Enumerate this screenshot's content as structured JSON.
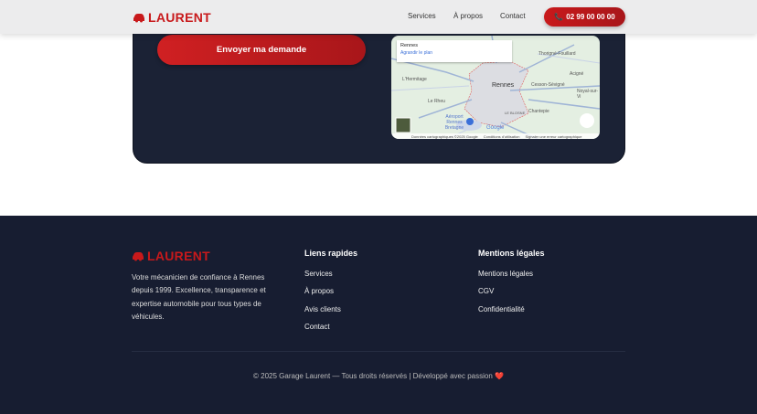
{
  "header": {
    "logo": "LAURENT",
    "nav": [
      "Services",
      "À propos",
      "Contact"
    ],
    "phone": "02 99 00 00 00"
  },
  "form": {
    "submit_label": "Envoyer ma demande"
  },
  "map": {
    "place": "Rennes",
    "enlarge_link": "Agrandir le plan",
    "labels": [
      "Thorigné-Fouillard",
      "L'Hermitage",
      "Rennes",
      "Cesson-Sévigné",
      "Acigné",
      "Noyal-sur-Vi",
      "Le Rheu",
      "LE BLOSNE",
      "Chantepie",
      "Aéroport Rennes Bretagne",
      "Google"
    ],
    "attribution": [
      "Données cartographiques ©2025 Google",
      "Conditions d'utilisation",
      "Signaler une erreur cartographique"
    ]
  },
  "footer": {
    "logo": "LAURENT",
    "description": "Votre mécanicien de confiance à Rennes depuis 1999. Excellence, transparence et expertise automobile pour tous types de véhicules.",
    "quick_title": "Liens rapides",
    "quick_links": [
      "Services",
      "À propos",
      "Avis clients",
      "Contact"
    ],
    "legal_title": "Mentions légales",
    "legal_links": [
      "Mentions légales",
      "CGV",
      "Confidentialité"
    ],
    "copyright": "© 2025 Garage Laurent — Tous droits réservés | Développé avec passion ❤️"
  },
  "colors": {
    "brand": "#c8191b",
    "dark": "#1b2235",
    "footer": "#171d31"
  }
}
